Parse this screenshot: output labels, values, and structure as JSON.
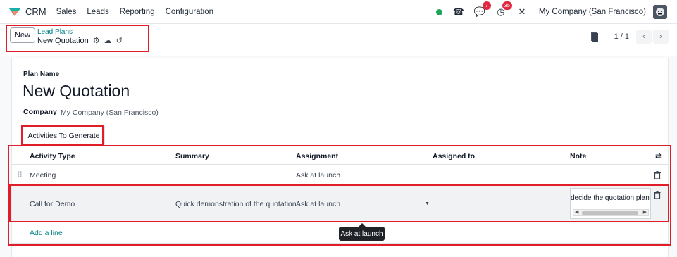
{
  "navbar": {
    "app_name": "CRM",
    "menu": [
      "Sales",
      "Leads",
      "Reporting",
      "Configuration"
    ],
    "badges": {
      "messages": "7",
      "activities": "35"
    },
    "company": "My Company (San Francisco)"
  },
  "control": {
    "new_label": "New",
    "breadcrumb_parent": "Lead Plans",
    "breadcrumb_current": "New Quotation",
    "pager": "1 / 1"
  },
  "form": {
    "plan_name_label": "Plan Name",
    "plan_name": "New Quotation",
    "company_label": "Company",
    "company_value": "My Company (San Francisco)",
    "tab_label": "Activities To Generate"
  },
  "table": {
    "headers": {
      "activity_type": "Activity Type",
      "summary": "Summary",
      "assignment": "Assignment",
      "assigned_to": "Assigned to",
      "note": "Note"
    },
    "rows": [
      {
        "activity_type": "Meeting",
        "summary": "",
        "assignment": "Ask at launch",
        "assigned_to": "",
        "note": ""
      },
      {
        "activity_type": "Call for Demo",
        "summary": "Quick demonstration of the quotation",
        "assignment": "Ask at launch",
        "assigned_to": "",
        "note": "decide the quotation plan"
      }
    ],
    "add_line": "Add a line"
  },
  "tooltip": "Ask at launch",
  "colors": {
    "accent": "#017e84",
    "annotation": "#e11d2a",
    "badge": "#e0293e"
  }
}
